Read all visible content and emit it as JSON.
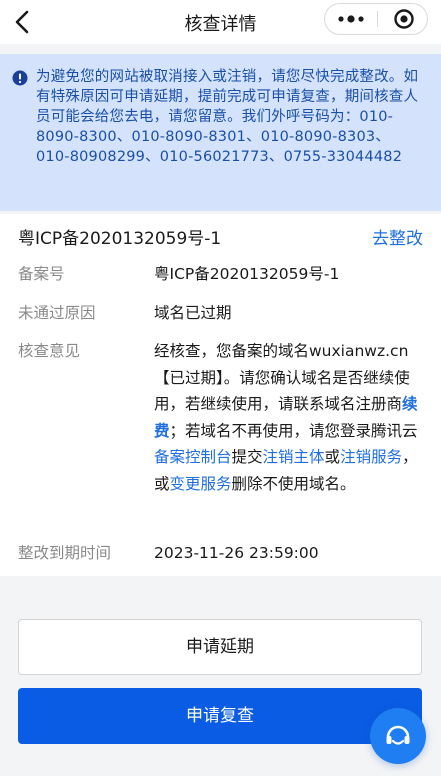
{
  "nav": {
    "title": "核查详情"
  },
  "notice": {
    "text": "为避免您的网站被取消接入或注销，请您尽快完成整改。如有特殊原因可申请延期，提前完成可申请复查，期间核查人员可能会给您去电，请您留意。我们外呼号码为：010-8090-8300、010-8090-8301、010-8090-8303、 010-80908299、010-56021773、0755-33044482"
  },
  "record": {
    "header_title": "粤ICP备2020132059号-1",
    "fix_link": "去整改",
    "filing_label": "备案号",
    "filing_value": "粤ICP备2020132059号-1",
    "reason_label": "未通过原因",
    "reason_value": "域名已过期",
    "opinion_label": "核查意见",
    "opinion": {
      "p1": "经核查，您备案的域名wuxianwz.cn【已过期】。请您确认域名是否继续使用，若继续使用，请联系域名注册商",
      "link_renew": "续费",
      "p2": "；若域名不再使用，请您登录腾讯云",
      "link_console": "备案控制台",
      "p3": "提交",
      "link_cancel_entity": "注销主体",
      "p4": "或",
      "link_cancel_service": "注销服务",
      "p5": "，或",
      "link_change_service": "变更服务",
      "p6": "删除不使用域名。"
    },
    "deadline_label": "整改到期时间",
    "deadline_value": "2023-11-26 23:59:00"
  },
  "buttons": {
    "extend": "申请延期",
    "recheck": "申请复查"
  },
  "colors": {
    "accent": "#1f6fe0",
    "primary_button": "#0a5ce4",
    "notice_bg": "#d4e3fb",
    "notice_text": "#1a4fa8"
  },
  "icons": {
    "back": "chevron-left-icon",
    "more": "more-dots-icon",
    "close": "target-circle-icon",
    "info": "info-icon",
    "support": "headset-icon"
  }
}
